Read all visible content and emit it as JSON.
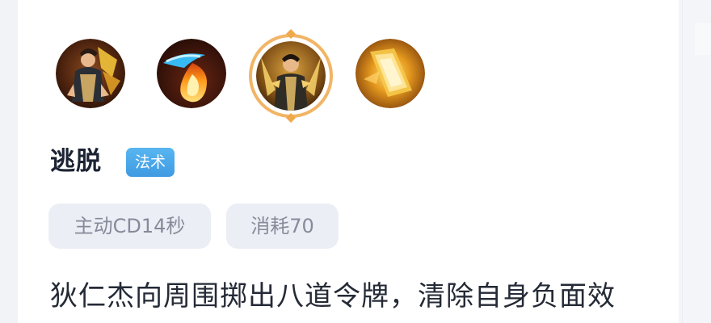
{
  "skills": [
    {
      "name": "hero-portrait-icon",
      "selected": false
    },
    {
      "name": "flame-token-icon",
      "selected": false
    },
    {
      "name": "escape-skill-icon",
      "selected": true
    },
    {
      "name": "golden-token-burst-icon",
      "selected": false
    }
  ],
  "skill": {
    "name": "逃脱",
    "type": "法术",
    "tags": {
      "cooldown": "主动CD14秒",
      "cost": "消耗70"
    },
    "description": "狄仁杰向周围掷出八道令牌，清除自身负面效"
  },
  "colors": {
    "badge": "#4aa6ea",
    "selected_ring": "#f0b15b",
    "tag_bg": "#eceef5",
    "text_dark": "#1c2333"
  }
}
